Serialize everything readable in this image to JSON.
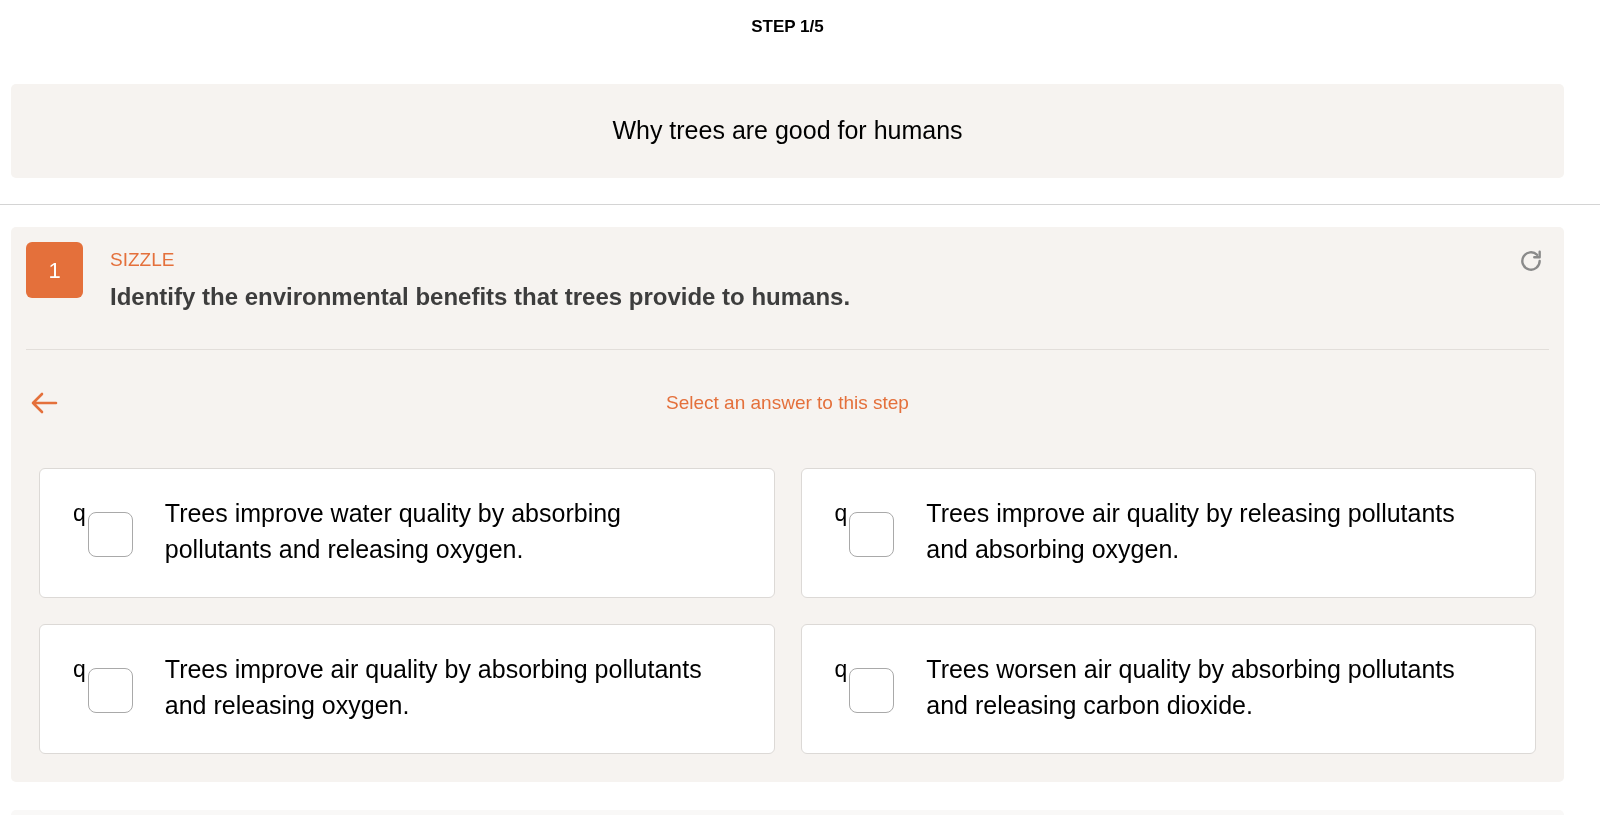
{
  "progress": {
    "label": "STEP 1/5"
  },
  "topic": {
    "title": "Why trees are good for humans"
  },
  "step": {
    "number": "1",
    "category": "SIZZLE",
    "question": "Identify the environmental benefits that trees provide to humans.",
    "instruction": "Select an answer to this step",
    "options": [
      {
        "marker": "q",
        "text": "Trees improve water quality by absorbing pollutants and releasing oxygen.",
        "checked": false
      },
      {
        "marker": "q",
        "text": "Trees improve air quality by releasing pollutants and absorbing oxygen.",
        "checked": false
      },
      {
        "marker": "q",
        "text": "Trees improve air quality by absorbing pollutants and releasing oxygen.",
        "checked": false
      },
      {
        "marker": "q",
        "text": "Trees worsen air quality by absorbing pollutants and releasing carbon dioxide.",
        "checked": false
      }
    ]
  }
}
